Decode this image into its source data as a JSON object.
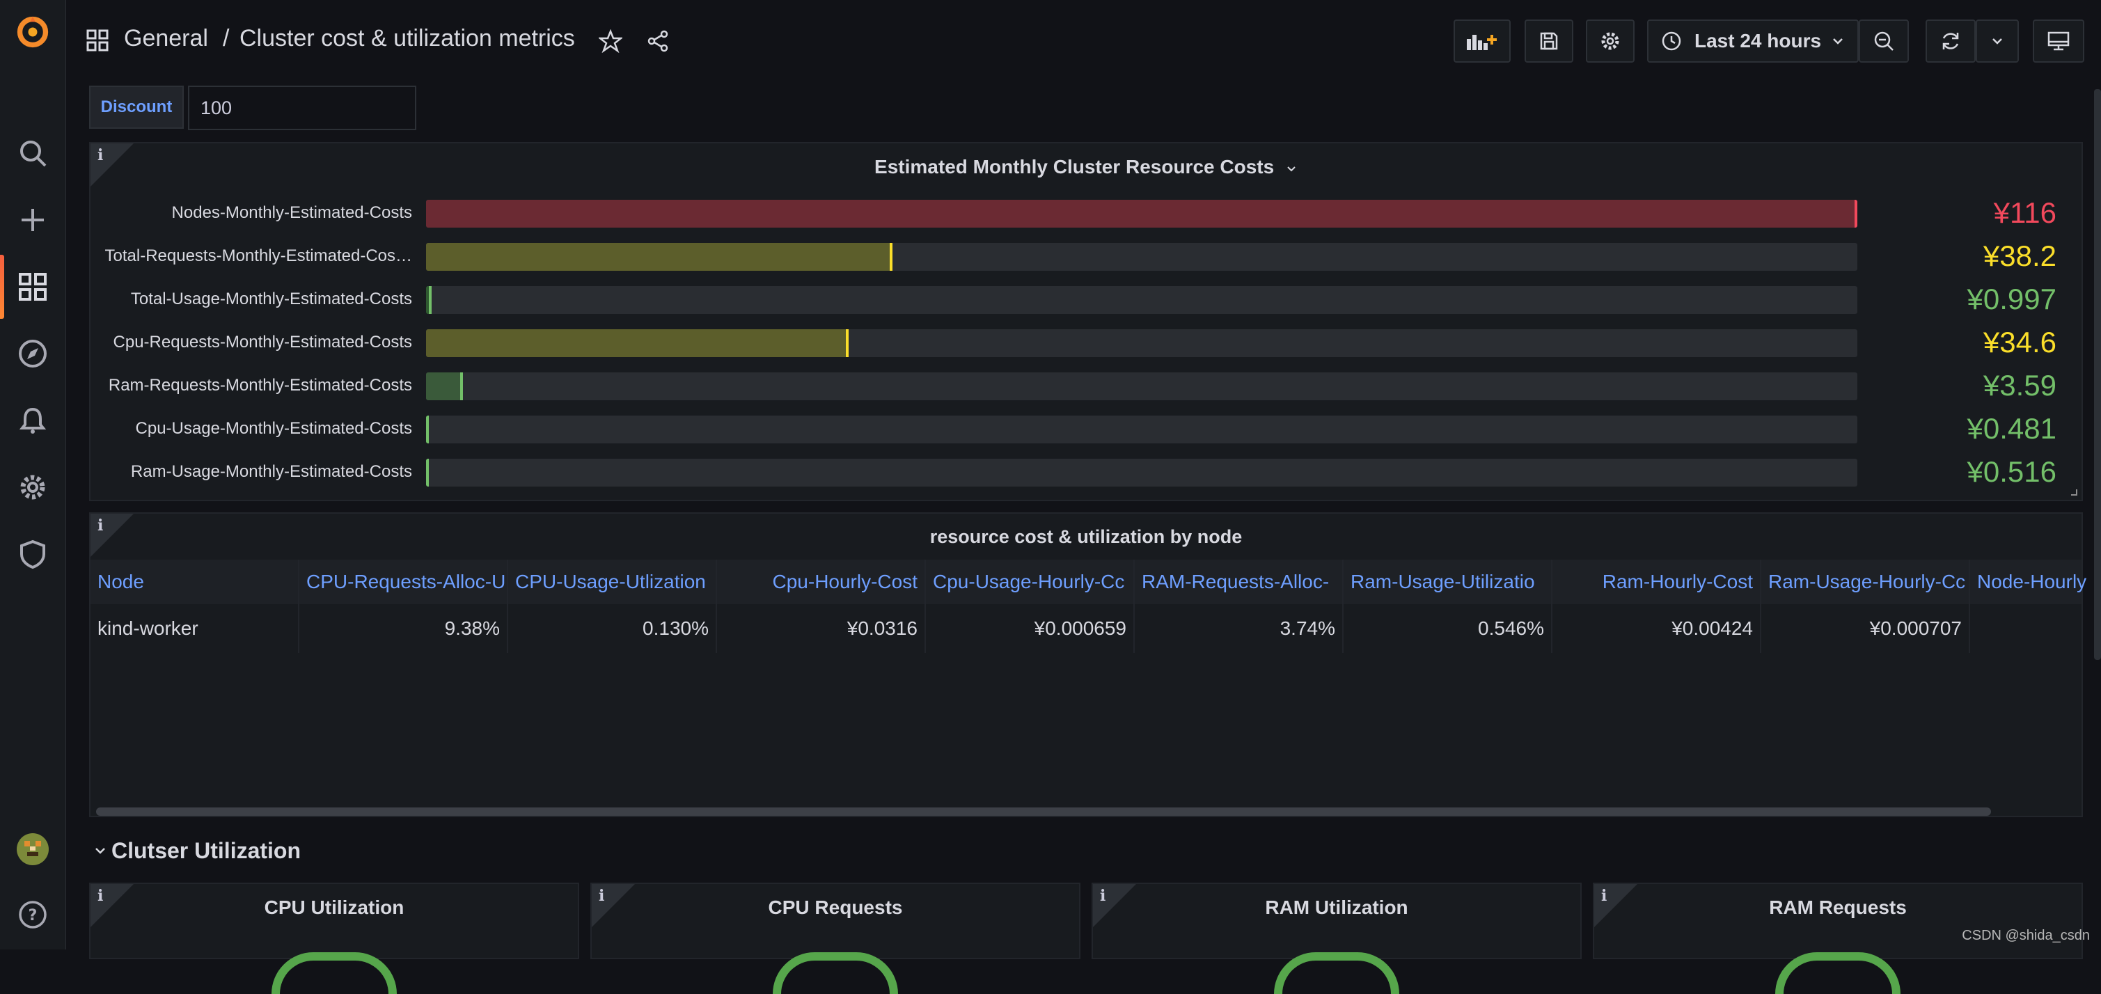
{
  "breadcrumb": {
    "folder": "General",
    "separator": "/",
    "title": "Cluster cost & utilization metrics"
  },
  "toolbar": {
    "time_range": "Last 24 hours"
  },
  "variable": {
    "label": "Discount",
    "value": "100"
  },
  "bar_panel": {
    "title": "Estimated Monthly Cluster Resource Costs",
    "rows": [
      {
        "label": "Nodes-Monthly-Estimated-Costs",
        "value": "¥116",
        "fraction": 1.0,
        "color": "#f2495c",
        "fill": "#6b2a33"
      },
      {
        "label": "Total-Requests-Monthly-Estimated-Cos…",
        "value": "¥38.2",
        "fraction": 0.326,
        "color": "#fade2a",
        "fill": "#5c5e2b"
      },
      {
        "label": "Total-Usage-Monthly-Estimated-Costs",
        "value": "¥0.997",
        "fraction": 0.004,
        "color": "#73bf69",
        "fill": "#2f5a31"
      },
      {
        "label": "Cpu-Requests-Monthly-Estimated-Costs",
        "value": "¥34.6",
        "fraction": 0.295,
        "color": "#fade2a",
        "fill": "#5c5e2b"
      },
      {
        "label": "Ram-Requests-Monthly-Estimated-Costs",
        "value": "¥3.59",
        "fraction": 0.026,
        "color": "#73bf69",
        "fill": "#3a5a3a"
      },
      {
        "label": "Cpu-Usage-Monthly-Estimated-Costs",
        "value": "¥0.481",
        "fraction": 0.002,
        "color": "#73bf69",
        "fill": "#2f5a31"
      },
      {
        "label": "Ram-Usage-Monthly-Estimated-Costs",
        "value": "¥0.516",
        "fraction": 0.002,
        "color": "#73bf69",
        "fill": "#2f5a31"
      }
    ]
  },
  "table_panel": {
    "title": "resource cost & utilization by node",
    "columns": [
      "Node",
      "CPU-Requests-Alloc-U",
      "CPU-Usage-Utlization",
      "Cpu-Hourly-Cost",
      "Cpu-Usage-Hourly-Cc",
      "RAM-Requests-Alloc-",
      "Ram-Usage-Utilizatio",
      "Ram-Hourly-Cost",
      "Ram-Usage-Hourly-Cc",
      "Node-Hourly"
    ],
    "rows": [
      [
        "kind-worker",
        "9.38%",
        "0.130%",
        "¥0.0316",
        "¥0.000659",
        "3.74%",
        "0.546%",
        "¥0.00424",
        "¥0.000707",
        ""
      ]
    ]
  },
  "row_section": {
    "title": "Clutser Utilization"
  },
  "gauges": [
    {
      "title": "CPU Utilization"
    },
    {
      "title": "CPU Requests"
    },
    {
      "title": "RAM Utilization"
    },
    {
      "title": "RAM Requests"
    }
  ],
  "watermark": "CSDN @shida_csdn"
}
